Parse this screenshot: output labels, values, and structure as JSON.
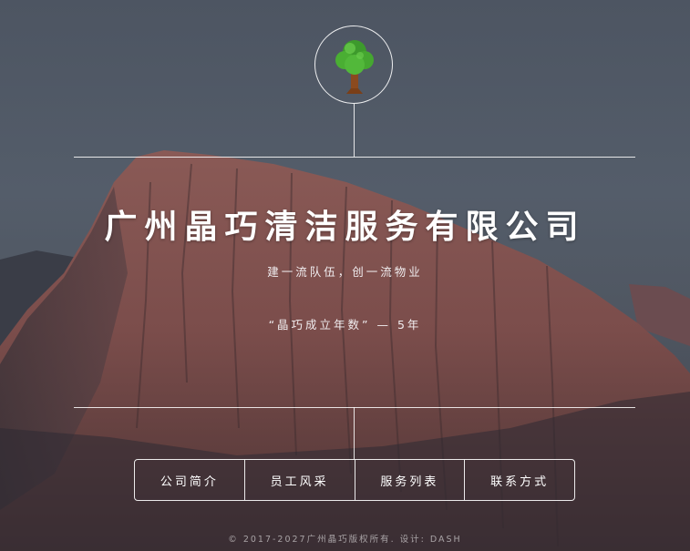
{
  "header": {
    "logo": "tree-icon"
  },
  "company": {
    "name": "广州晶巧清洁服务有限公司",
    "slogan": "建一流队伍，创一流物业",
    "years_text": "“晶巧成立年数” — 5年"
  },
  "nav": {
    "items": [
      {
        "label": "公司简介"
      },
      {
        "label": "员工风采"
      },
      {
        "label": "服务列表"
      },
      {
        "label": "联系方式"
      }
    ]
  },
  "footer": {
    "copyright": "© 2017-2027广州晶巧版权所有. 设计: DASH"
  }
}
